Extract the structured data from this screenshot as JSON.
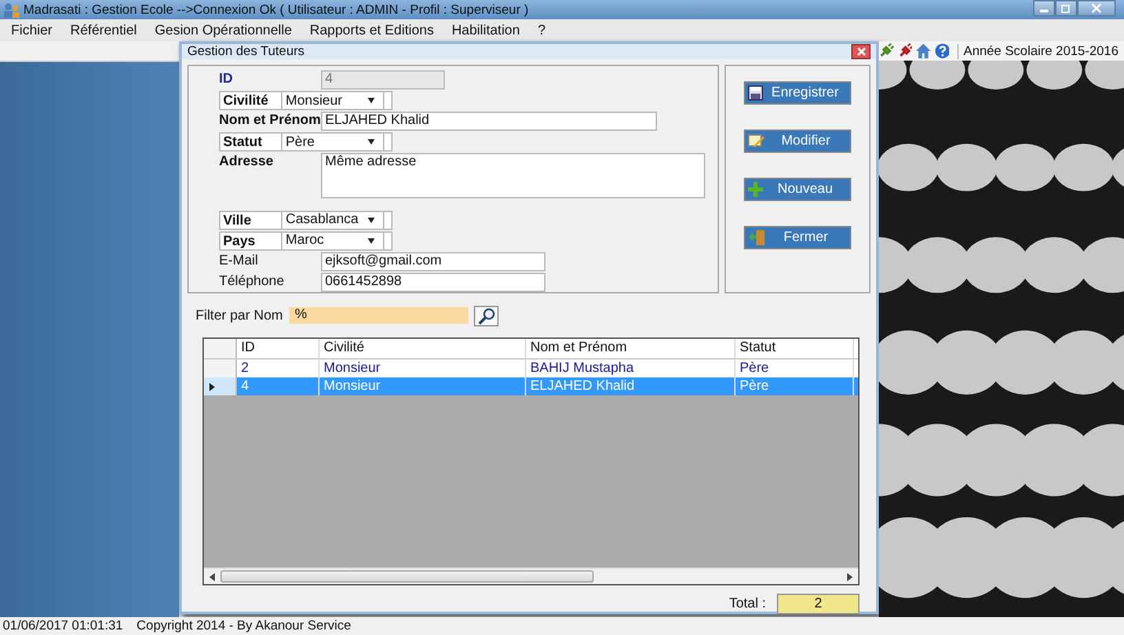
{
  "window": {
    "title": "Madrasati : Gestion Ecole -->Connexion Ok ( Utilisateur : ADMIN - Profil : Superviseur )"
  },
  "menu": [
    "Fichier",
    "Référentiel",
    "Gesion Opérationnelle",
    "Rapports et Editions",
    "Habilitation",
    "?"
  ],
  "toolbar": {
    "year_label": "Année Scolaire 2015-2016"
  },
  "dialog": {
    "title": "Gestion des Tuteurs",
    "fields": [
      {
        "label": "ID",
        "bold": true,
        "color": "#1a2a9a",
        "kind": "short",
        "value": "4",
        "disabled": true
      },
      {
        "label": "Civilité",
        "bold": true,
        "color": "#111111",
        "kind": "combo",
        "value": "Monsieur",
        "disabled": false
      },
      {
        "label": "Nom et Prénom",
        "bold": true,
        "color": "#111111",
        "kind": "wide",
        "value": "ELJAHED Khalid",
        "disabled": false
      },
      {
        "label": "Statut",
        "bold": true,
        "color": "#111111",
        "kind": "combo",
        "value": "Père",
        "disabled": false
      },
      {
        "label": "Adresse",
        "bold": true,
        "color": "#111111",
        "kind": "textarea",
        "value": "Même adresse",
        "disabled": false
      },
      {
        "label": "Ville",
        "bold": true,
        "color": "#111111",
        "kind": "combo",
        "value": "Casablanca",
        "disabled": false
      },
      {
        "label": "Pays",
        "bold": true,
        "color": "#111111",
        "kind": "combo",
        "value": "Maroc",
        "disabled": false
      },
      {
        "label": "E-Mail",
        "bold": false,
        "color": "#111111",
        "kind": "text",
        "value": "ejksoft@gmail.com",
        "disabled": false
      },
      {
        "label": "Téléphone",
        "bold": false,
        "color": "#111111",
        "kind": "text",
        "value": "0661452898",
        "disabled": false
      }
    ],
    "buttons": [
      {
        "label": "Enregistrer",
        "kind": "save"
      },
      {
        "label": "Modifier",
        "kind": "edit"
      },
      {
        "label": "Nouveau",
        "kind": "add"
      },
      {
        "label": "Fermer",
        "kind": "exit"
      }
    ],
    "filter": {
      "label": "Filter par Nom",
      "value": "%"
    },
    "grid": {
      "columns": [
        "ID",
        "Civilité",
        "Nom et Prénom",
        "Statut"
      ],
      "rows": [
        {
          "cells": [
            "2",
            "Monsieur",
            "BAHIJ Mustapha",
            "Père"
          ],
          "selected": false
        },
        {
          "cells": [
            "4",
            "Monsieur",
            "ELJAHED Khalid",
            "Père"
          ],
          "selected": true
        }
      ]
    },
    "total": {
      "label": "Total :",
      "value": "2"
    }
  },
  "status_bar": [
    "01/06/2017 01:01:31",
    "Copyright 2014 - By Akanour Service"
  ]
}
